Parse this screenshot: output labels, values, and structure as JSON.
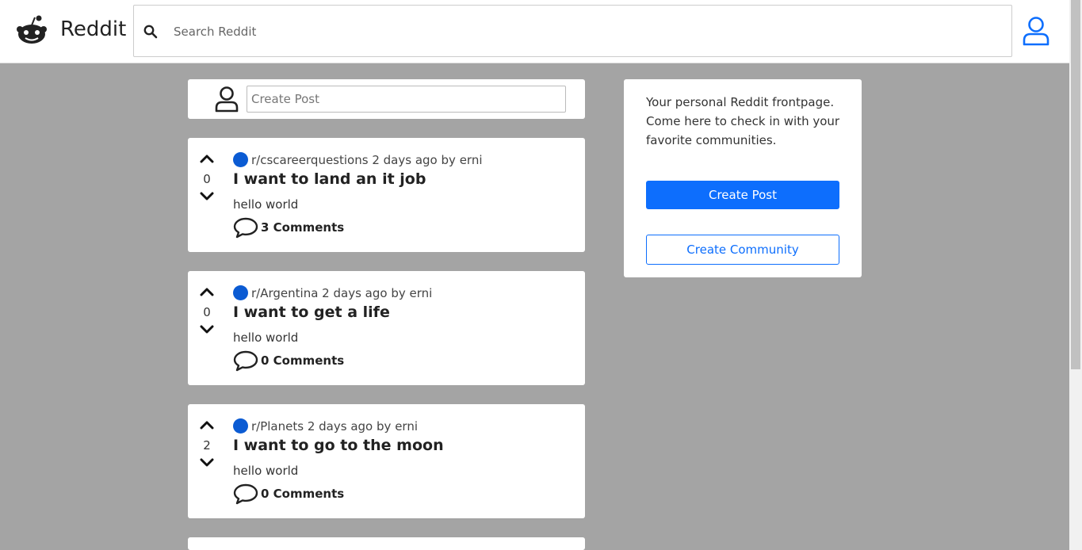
{
  "header": {
    "brand": "Reddit",
    "search_placeholder": "Search Reddit",
    "logo_icon": "reddit-alien-icon",
    "search_icon": "search-icon",
    "user_icon": "user-icon"
  },
  "create_bar": {
    "placeholder": "Create Post"
  },
  "posts": [
    {
      "subreddit": "r/cscareerquestions",
      "time": "2 days ago",
      "author_prefix": "by",
      "author": "erni",
      "title": "I want to land an it job",
      "body": "hello world",
      "votes": "0",
      "comments": "3 Comments"
    },
    {
      "subreddit": "r/Argentina",
      "time": "2 days ago",
      "author_prefix": "by",
      "author": "erni",
      "title": "I want to get a life",
      "body": "hello world",
      "votes": "0",
      "comments": "0 Comments"
    },
    {
      "subreddit": "r/Planets",
      "time": "2 days ago",
      "author_prefix": "by",
      "author": "erni",
      "title": "I want to go to the moon",
      "body": "hello world",
      "votes": "2",
      "comments": "0 Comments"
    }
  ],
  "sidebar": {
    "text": "Your personal Reddit frontpage. Come here to check in with your favorite communities.",
    "create_post": "Create Post",
    "create_community": "Create Community"
  },
  "colors": {
    "accent": "#0d6efd",
    "subreddit_dot": "#0b5bd3",
    "background": "#a4a4a4"
  }
}
